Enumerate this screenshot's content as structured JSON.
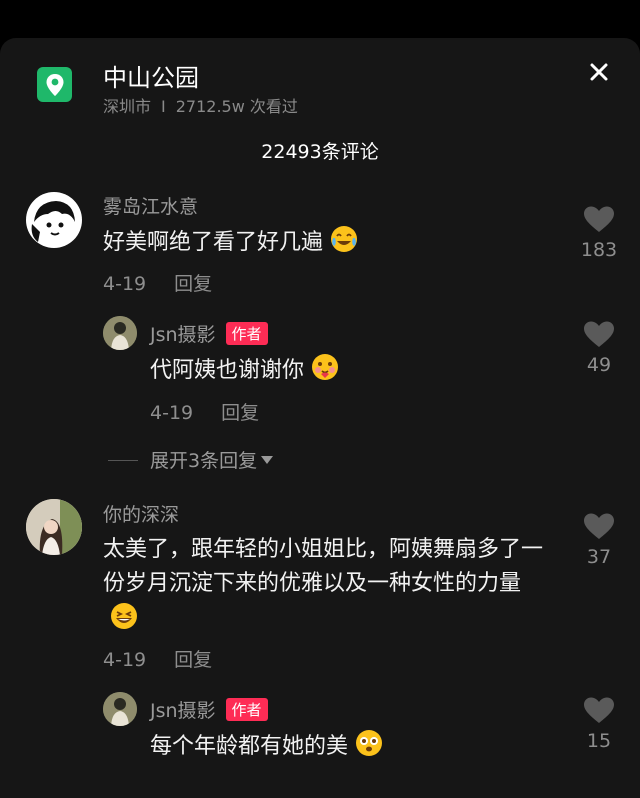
{
  "location": {
    "name": "中山公园",
    "city": "深圳市",
    "separator": "I",
    "views": "2712.5w 次看过",
    "pin_color": "#1fb86a"
  },
  "comment_count": "22493条评论",
  "author_badge": "作者",
  "comments": [
    {
      "user": "雾岛江水意",
      "text": "好美啊绝了看了好几遍",
      "date": "4-19",
      "reply": "回复",
      "likes": "183",
      "emoji": "laughing-tears-emoji",
      "replies": [
        {
          "user": "Jsn摄影",
          "text": "代阿姨也谢谢你",
          "date": "4-19",
          "reply": "回复",
          "likes": "49",
          "emoji": "blushing-emoji"
        }
      ],
      "expand": "展开3条回复"
    },
    {
      "user": "你的深深",
      "text": "太美了，跟年轻的小姐姐比，阿姨舞扇多了一份岁月沉淀下来的优雅以及一种女性的力量",
      "date": "4-19",
      "reply": "回复",
      "likes": "37",
      "emoji": "grinning-emoji",
      "replies": [
        {
          "user": "Jsn摄影",
          "text": "每个年龄都有她的美",
          "likes": "15",
          "emoji": "star-eyes-emoji"
        }
      ]
    }
  ],
  "accent_color": "#fe2c55"
}
